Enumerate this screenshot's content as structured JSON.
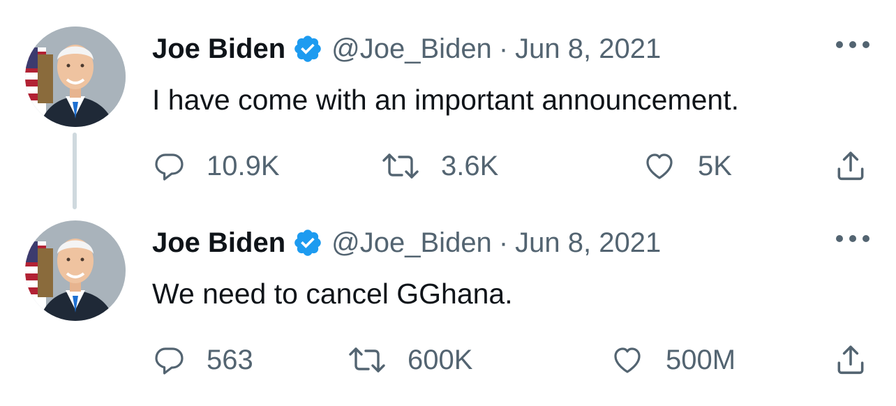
{
  "tweets": [
    {
      "name": "Joe Biden",
      "handle": "@Joe_Biden",
      "separator": "·",
      "date": "Jun 8, 2021",
      "text": "I have come with an important announcement.",
      "replies": "10.9K",
      "retweets": "3.6K",
      "likes": "5K"
    },
    {
      "name": "Joe Biden",
      "handle": "@Joe_Biden",
      "separator": "·",
      "date": "Jun 8, 2021",
      "text": "We need to cancel GGhana.",
      "replies": "563",
      "retweets": "600K",
      "likes": "500M"
    }
  ],
  "icons": {
    "reply": "reply-icon",
    "retweet": "retweet-icon",
    "like": "heart-icon",
    "share": "share-icon",
    "more": "more-icon",
    "verified": "verified-badge-icon"
  },
  "colors": {
    "text": "#0f1419",
    "secondary": "#536471",
    "verified": "#1d9bf0",
    "thread_line": "#cfd9de"
  }
}
